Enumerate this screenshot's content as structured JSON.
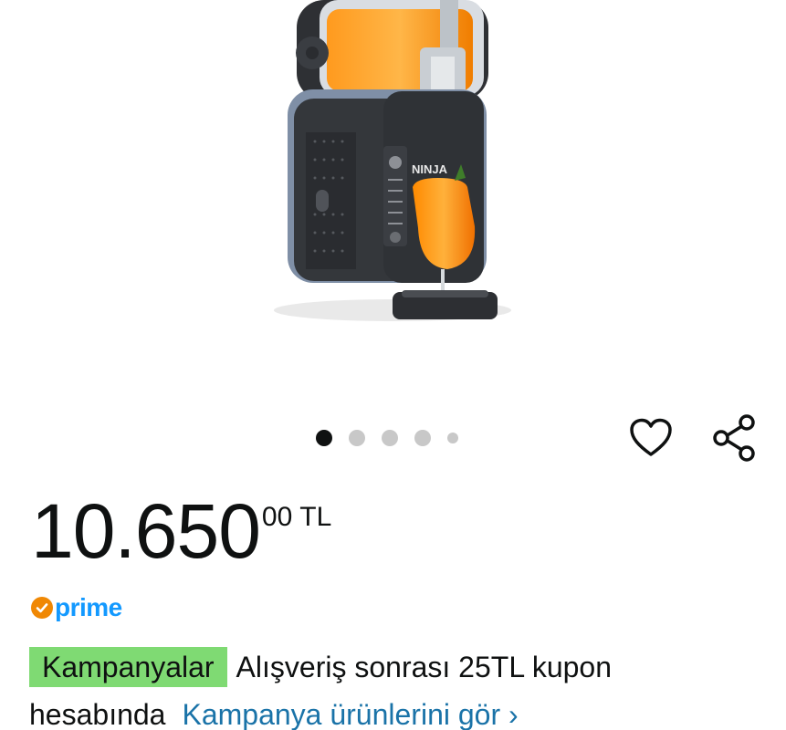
{
  "product": {
    "image_alt": "Ninja slush machine",
    "brand_mark": "NINJA"
  },
  "carousel": {
    "total_dots": 5,
    "active_index": 0
  },
  "actions": {
    "wishlist_icon": "heart-outline-icon",
    "share_icon": "share-icon"
  },
  "price": {
    "whole": "10.650",
    "fraction": "00",
    "currency": "TL"
  },
  "prime": {
    "label": "prime",
    "check_color": "#f08804",
    "text_color": "#1399ff"
  },
  "promo": {
    "badge": "Kampanyalar",
    "text_line1": "Alışveriş sonrası 25TL kupon",
    "text_line2": "hesabında",
    "link": "Kampanya ürünlerini gör",
    "link_chevron": "›",
    "badge_color": "#7fda73",
    "link_color": "#1a73a8"
  }
}
